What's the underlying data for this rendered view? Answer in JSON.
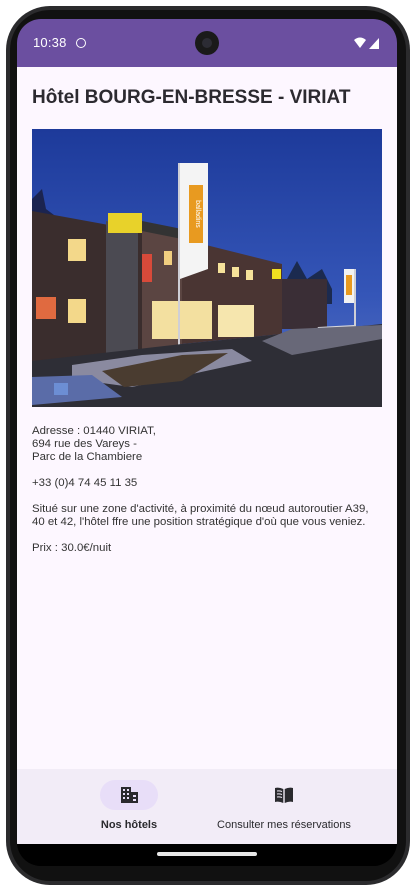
{
  "status_bar": {
    "time": "10:38",
    "accent_color": "#6b4fa0"
  },
  "hotel": {
    "title": "Hôtel BOURG-EN-BRESSE - VIRIAT",
    "photo_icon": "hotel-photo",
    "address_lines": [
      "Adresse : 01440 VIRIAT,",
      "694 rue des Vareys -",
      "Parc de la Chambiere"
    ],
    "phone": "+33 (0)4 74 45 11 35",
    "description": "Situé sur une zone d'activité, à proximité du nœud autoroutier A39, 40 et 42, l'hôtel ffre une position stratégique d'où que vous veniez.",
    "price": "Prix : 30.0€/nuit",
    "sign_text": "balladins"
  },
  "bottom_nav": {
    "items": [
      {
        "label": "Nos hôtels",
        "icon": "building-icon",
        "selected": true
      },
      {
        "label": "Consulter mes réservations",
        "icon": "book-icon",
        "selected": false
      }
    ],
    "selected_pill_color": "#e8def8",
    "background": "#f2ecf7"
  }
}
